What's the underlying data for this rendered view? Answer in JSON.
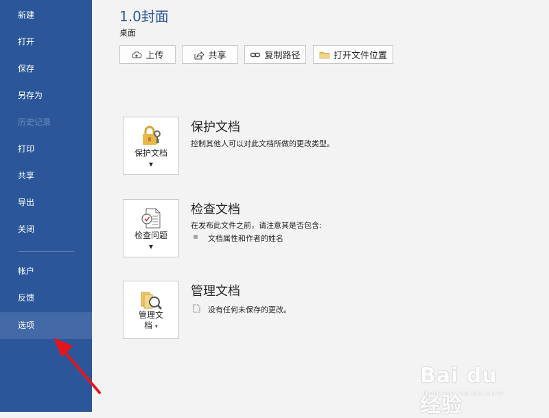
{
  "sidebar": {
    "items": [
      {
        "label": "新建",
        "state": "normal"
      },
      {
        "label": "打开",
        "state": "normal"
      },
      {
        "label": "保存",
        "state": "normal"
      },
      {
        "label": "另存为",
        "state": "normal"
      },
      {
        "label": "历史记录",
        "state": "disabled"
      },
      {
        "label": "打印",
        "state": "normal"
      },
      {
        "label": "共享",
        "state": "normal"
      },
      {
        "label": "导出",
        "state": "normal"
      },
      {
        "label": "关闭",
        "state": "normal"
      }
    ],
    "bottom_items": [
      {
        "label": "帐户"
      },
      {
        "label": "反馈"
      },
      {
        "label": "选项",
        "selected": true
      }
    ]
  },
  "header": {
    "title": "1.0封面",
    "location": "桌面"
  },
  "toolbar": {
    "upload_label": "上传",
    "share_label": "共享",
    "copy_path_label": "复制路径",
    "open_location_label": "打开文件位置"
  },
  "sections": {
    "protect": {
      "button_label": "保护文档",
      "title": "保护文档",
      "description": "控制其他人可以对此文档所做的更改类型。"
    },
    "inspect": {
      "button_label": "检查问题",
      "title": "检查文档",
      "description": "在发布此文件之前，请注意其是否包含:",
      "bullets": [
        "文档属性和作者的姓名"
      ]
    },
    "manage": {
      "button_label_line1": "管理文",
      "button_label_line2": "档",
      "title": "管理文档",
      "description": "没有任何未保存的更改。"
    }
  },
  "watermark": {
    "text": "Bai du 经验",
    "sub": "jingyan.baidu.com"
  },
  "colors": {
    "sidebar_bg": "#2b579a",
    "accent": "#2b579a",
    "annotation_arrow": "#e8141b"
  }
}
